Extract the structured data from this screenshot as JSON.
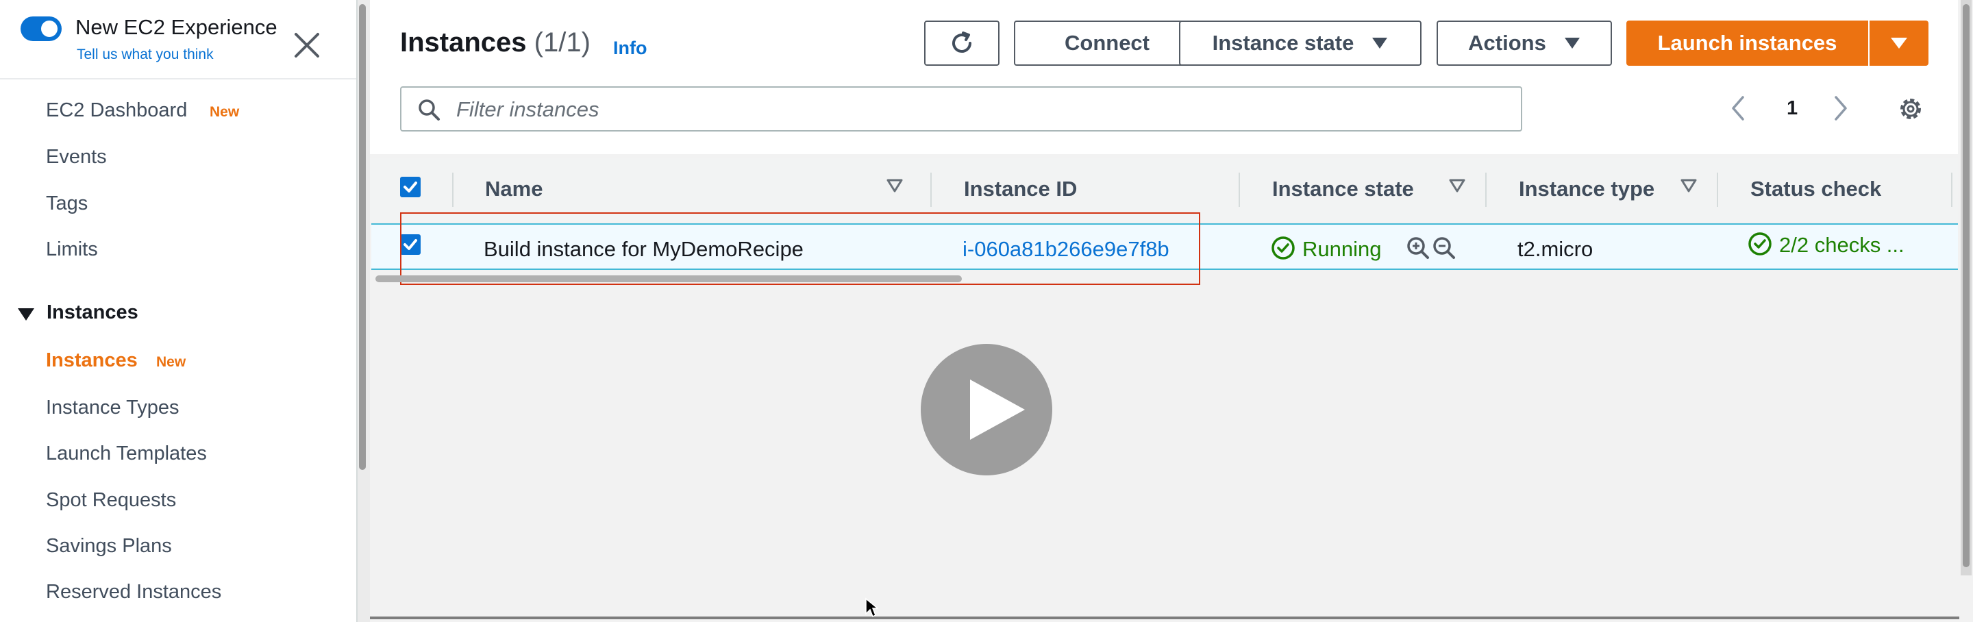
{
  "sidebar": {
    "experience_title": "New EC2 Experience",
    "experience_link": "Tell us what you think",
    "items_top": [
      {
        "label": "EC2 Dashboard",
        "badge": "New"
      },
      {
        "label": "Events"
      },
      {
        "label": "Tags"
      },
      {
        "label": "Limits"
      }
    ],
    "section_header": "Instances",
    "items_instances": [
      {
        "label": "Instances",
        "badge": "New",
        "active": true
      },
      {
        "label": "Instance Types"
      },
      {
        "label": "Launch Templates"
      },
      {
        "label": "Spot Requests"
      },
      {
        "label": "Savings Plans"
      },
      {
        "label": "Reserved Instances"
      }
    ]
  },
  "header": {
    "title": "Instances",
    "count": "(1/1)",
    "info": "Info",
    "connect_label": "Connect",
    "instance_state_label": "Instance state",
    "actions_label": "Actions",
    "launch_label": "Launch instances"
  },
  "search": {
    "placeholder": "Filter instances"
  },
  "pagination": {
    "current_page": "1"
  },
  "table": {
    "columns": [
      "Name",
      "Instance ID",
      "Instance state",
      "Instance type",
      "Status check"
    ],
    "row": {
      "name": "Build instance for MyDemoRecipe",
      "instance_id": "i-060a81b266e9e7f8b",
      "state": "Running",
      "type": "t2.micro",
      "status": "2/2 checks ..."
    }
  },
  "colors": {
    "accent_blue": "#0972d3",
    "orange": "#ec7211",
    "green": "#1d8102"
  },
  "icons": [
    "toggle-switch",
    "close-icon",
    "caret-down-icon",
    "refresh-icon",
    "search-icon",
    "chevron-left-icon",
    "chevron-right-icon",
    "gear-icon",
    "sort-icon",
    "check-circle-icon",
    "zoom-in-icon",
    "zoom-out-icon",
    "play-icon",
    "mouse-cursor-icon"
  ]
}
